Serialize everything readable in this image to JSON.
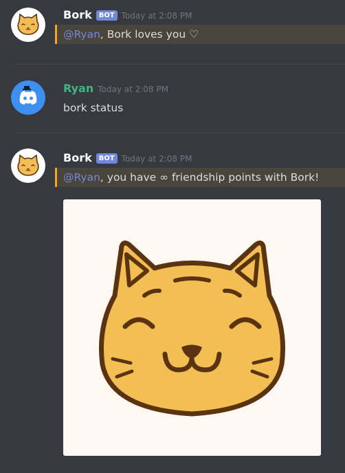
{
  "messages": [
    {
      "author": "Bork",
      "author_color": "#ffffff",
      "tag": "BOT",
      "time": "Today at 2:08 PM",
      "mention": "@Ryan",
      "text": ", Bork loves you ♡",
      "highlighted": true
    },
    {
      "author": "Ryan",
      "author_color": "#43b581",
      "time": "Today at 2:08 PM",
      "text": "bork status"
    },
    {
      "author": "Bork",
      "author_color": "#ffffff",
      "tag": "BOT",
      "time": "Today at 2:08 PM",
      "mention": "@Ryan",
      "text": ", you have ∞ friendship points with Bork!",
      "highlighted": true,
      "attachment": "cat-face-image"
    }
  ],
  "colors": {
    "background": "#36393f",
    "mention": "#7289da",
    "highlight_bar": "#faa61a",
    "bot_tag": "#7289da",
    "timestamp": "#72767d"
  }
}
